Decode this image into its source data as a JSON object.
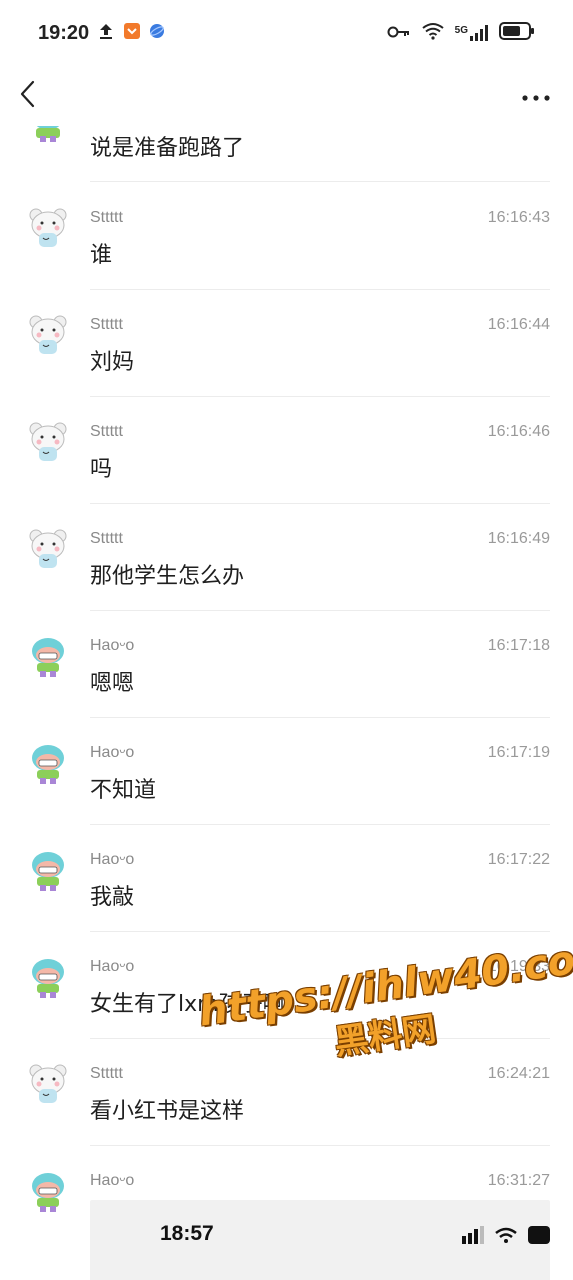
{
  "status_bar": {
    "time": "19:20",
    "network": "5G"
  },
  "messages_partial": {
    "content": "说是准备跑路了"
  },
  "messages": [
    {
      "sender": "Sttttt",
      "time": "16:16:43",
      "content": "谁",
      "avatar": "bear"
    },
    {
      "sender": "Sttttt",
      "time": "16:16:44",
      "content": "刘妈",
      "avatar": "bear"
    },
    {
      "sender": "Sttttt",
      "time": "16:16:46",
      "content": "吗",
      "avatar": "bear"
    },
    {
      "sender": "Sttttt",
      "time": "16:16:49",
      "content": "那他学生怎么办",
      "avatar": "bear"
    },
    {
      "sender": "Haoᵕo",
      "time": "16:17:18",
      "content": "嗯嗯",
      "avatar": "cartoon"
    },
    {
      "sender": "Haoᵕo",
      "time": "16:17:19",
      "content": "不知道",
      "avatar": "cartoon"
    },
    {
      "sender": "Haoᵕo",
      "time": "16:17:22",
      "content": "我敲",
      "avatar": "cartoon"
    },
    {
      "sender": "Haoᵕo",
      "time": "16:19:33",
      "content": "女生有了lxm孩子啊",
      "avatar": "cartoon"
    },
    {
      "sender": "Sttttt",
      "time": "16:24:21",
      "content": "看小红书是这样",
      "avatar": "bear"
    }
  ],
  "last_message": {
    "sender": "Haoᵕo",
    "time": "16:31:27",
    "screenshot_time": "18:57"
  },
  "watermark": {
    "url": "https://ihlw40.com",
    "name": "黑料网"
  }
}
